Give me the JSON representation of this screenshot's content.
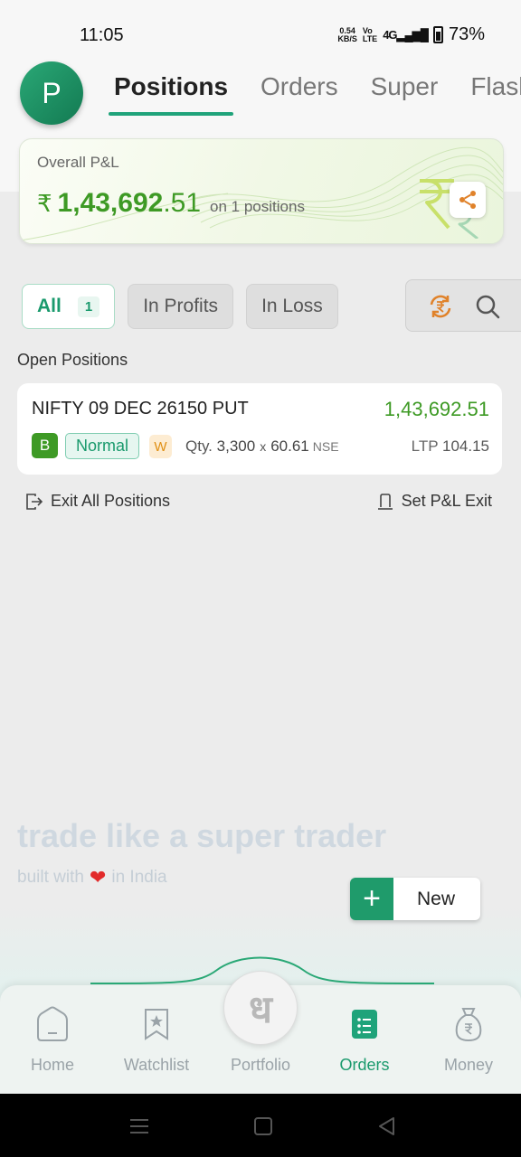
{
  "status_bar": {
    "time": "11:05",
    "net_speed_value": "0.54",
    "net_speed_unit": "KB/S",
    "volte_top": "Vo",
    "volte_bottom": "LTE",
    "signal": "4G",
    "battery": "73%"
  },
  "header": {
    "avatar_letter": "P",
    "tabs": [
      {
        "label": "Positions",
        "active": true
      },
      {
        "label": "Orders",
        "active": false
      },
      {
        "label": "Super",
        "active": false
      },
      {
        "label": "Flash",
        "active": false
      }
    ]
  },
  "pnl": {
    "label": "Overall P&L",
    "currency": "₹",
    "value_int": "1,43,692",
    "value_dec": ".51",
    "sub": "on 1 positions"
  },
  "filters": {
    "all_label": "All",
    "all_count": "1",
    "profits_label": "In Profits",
    "loss_label": "In Loss"
  },
  "open_positions": {
    "title": "Open Positions",
    "items": [
      {
        "name": "NIFTY 09 DEC 26150 PUT",
        "pnl": "1,43,692.51",
        "side": "B",
        "type": "Normal",
        "flag": "W",
        "qty_label": "Qty.",
        "qty": "3,300",
        "x": "x",
        "price": "60.61",
        "exchange": "NSE",
        "ltp_label": "LTP",
        "ltp": "104.15"
      }
    ]
  },
  "actions": {
    "exit_all": "Exit All Positions",
    "set_pnl_exit": "Set P&L Exit"
  },
  "branding": {
    "tagline": "trade like a super trader",
    "built_prefix": "built with",
    "heart": "❤",
    "built_suffix": "in India"
  },
  "new_button": {
    "plus": "+",
    "label": "New"
  },
  "bottom_nav": {
    "items": [
      {
        "label": "Home",
        "icon": "home-icon"
      },
      {
        "label": "Watchlist",
        "icon": "bookmark-star-icon"
      },
      {
        "label": "Portfolio",
        "icon": "portfolio-logo-icon"
      },
      {
        "label": "Orders",
        "icon": "orders-list-icon",
        "active": true
      },
      {
        "label": "Money",
        "icon": "money-bag-icon"
      }
    ],
    "portfolio_glyph": "ध"
  },
  "colors": {
    "accent": "#1fa37a",
    "profit": "#3e9a25"
  }
}
